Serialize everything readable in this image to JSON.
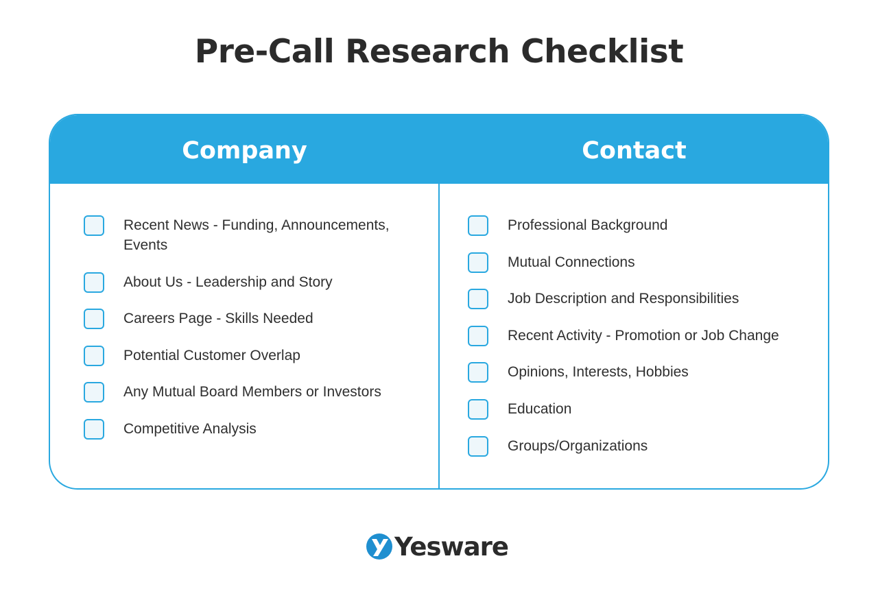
{
  "title": "Pre-Call Research Checklist",
  "brand_color": "#29a8e0",
  "columns": [
    {
      "heading": "Company",
      "items": [
        {
          "label": "Recent News - Funding, Announcements, Events",
          "checked": false
        },
        {
          "label": "About Us - Leadership and Story",
          "checked": false
        },
        {
          "label": "Careers Page - Skills Needed",
          "checked": false
        },
        {
          "label": "Potential Customer Overlap",
          "checked": false
        },
        {
          "label": "Any Mutual Board Members or Investors",
          "checked": false
        },
        {
          "label": "Competitive Analysis",
          "checked": false
        }
      ]
    },
    {
      "heading": "Contact",
      "items": [
        {
          "label": "Professional Background",
          "checked": false
        },
        {
          "label": "Mutual Connections",
          "checked": false
        },
        {
          "label": "Job Description and Responsibilities",
          "checked": false
        },
        {
          "label": "Recent Activity - Promotion or Job Change",
          "checked": false
        },
        {
          "label": "Opinions, Interests, Hobbies",
          "checked": false
        },
        {
          "label": "Education",
          "checked": false
        },
        {
          "label": "Groups/Organizations",
          "checked": false
        }
      ]
    }
  ],
  "logo": {
    "icon": "yesware-y-icon",
    "text": "Yesware"
  }
}
